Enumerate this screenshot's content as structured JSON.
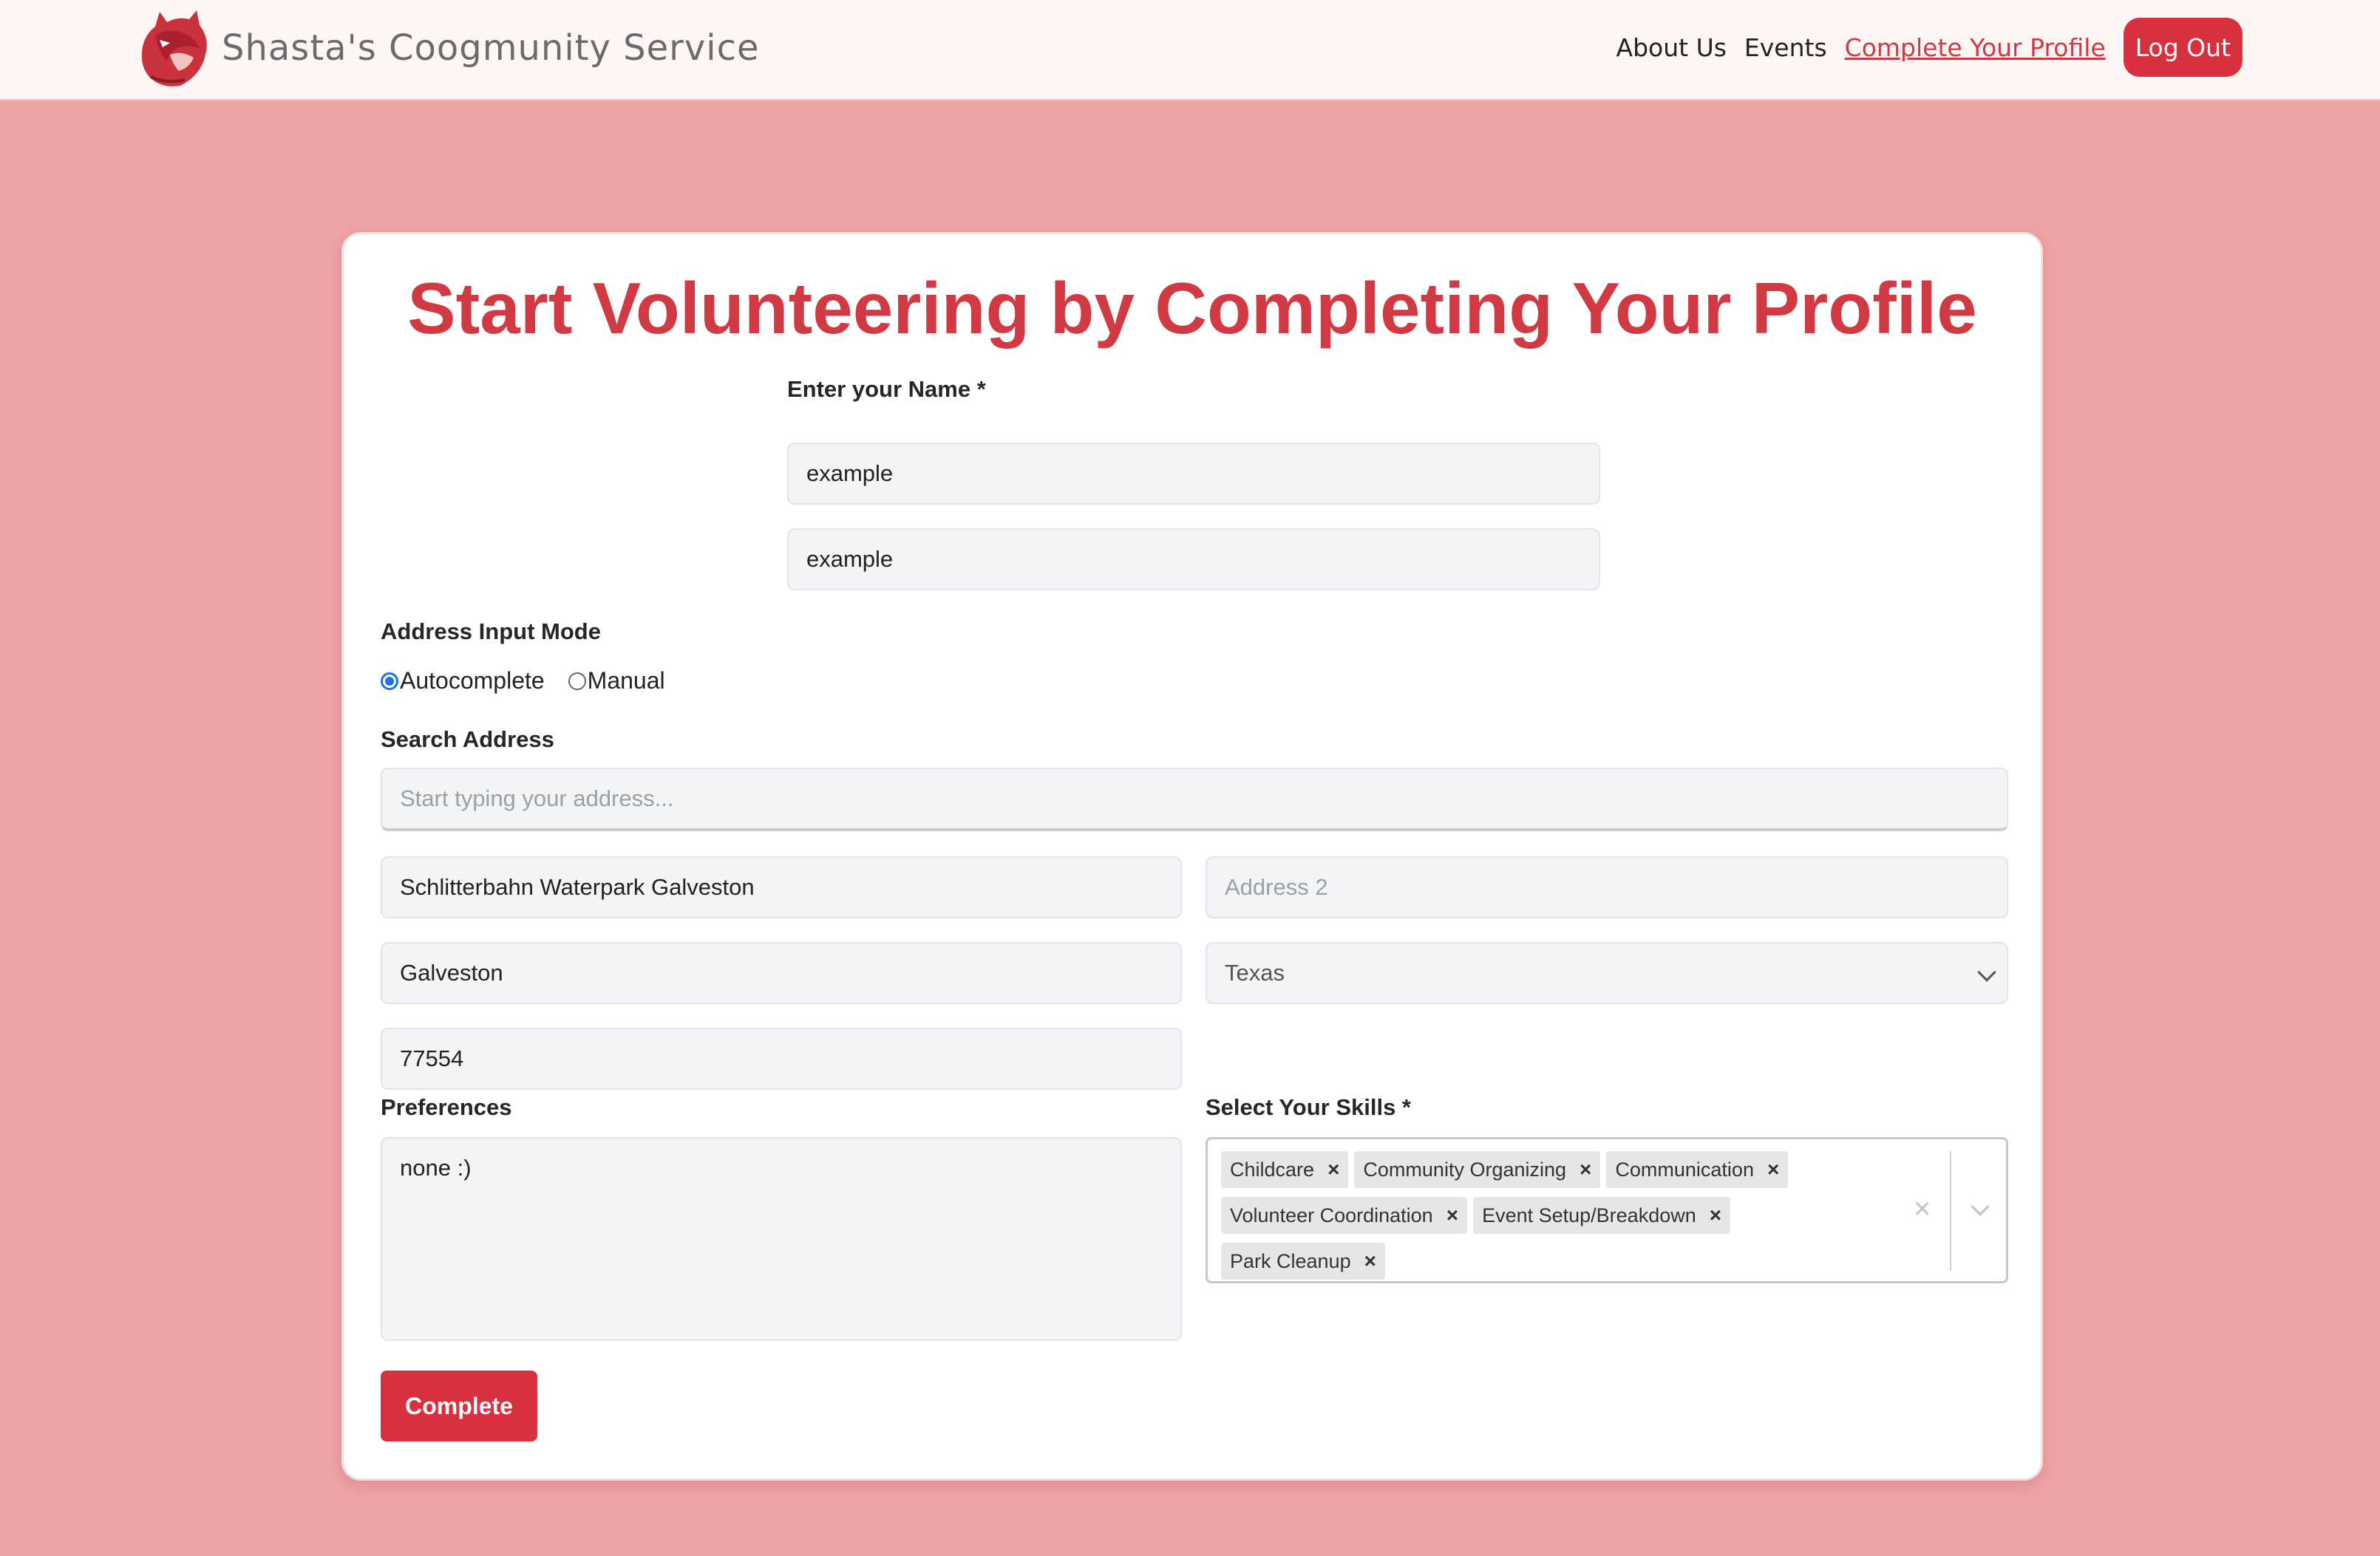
{
  "nav": {
    "brand": "Shasta's Coogmunity Service",
    "links": [
      "About Us",
      "Events",
      "Complete Your Profile"
    ],
    "logout": "Log Out"
  },
  "page": {
    "title": "Start Volunteering by Completing Your Profile"
  },
  "form": {
    "name_label": "Enter your Name *",
    "first_name": "example",
    "last_name": "example",
    "address_mode_label": "Address Input Mode",
    "mode_options": [
      "Autocomplete",
      "Manual"
    ],
    "search_label": "Search Address",
    "search_placeholder": "Start typing your address...",
    "address1": "Schlitterbahn Waterpark Galveston",
    "address2_placeholder": "Address 2",
    "city": "Galveston",
    "state": "Texas",
    "zip": "77554",
    "preferences_label": "Preferences",
    "preferences": "none :)",
    "skills_label": "Select Your Skills *",
    "skills": [
      "Childcare",
      "Community Organizing",
      "Communication",
      "Volunteer Coordination",
      "Event Setup/Breakdown",
      "Park Cleanup"
    ],
    "submit": "Complete"
  },
  "colors": {
    "accent": "#d13a43",
    "background": "#eea3a6",
    "button": "#d7303e"
  }
}
